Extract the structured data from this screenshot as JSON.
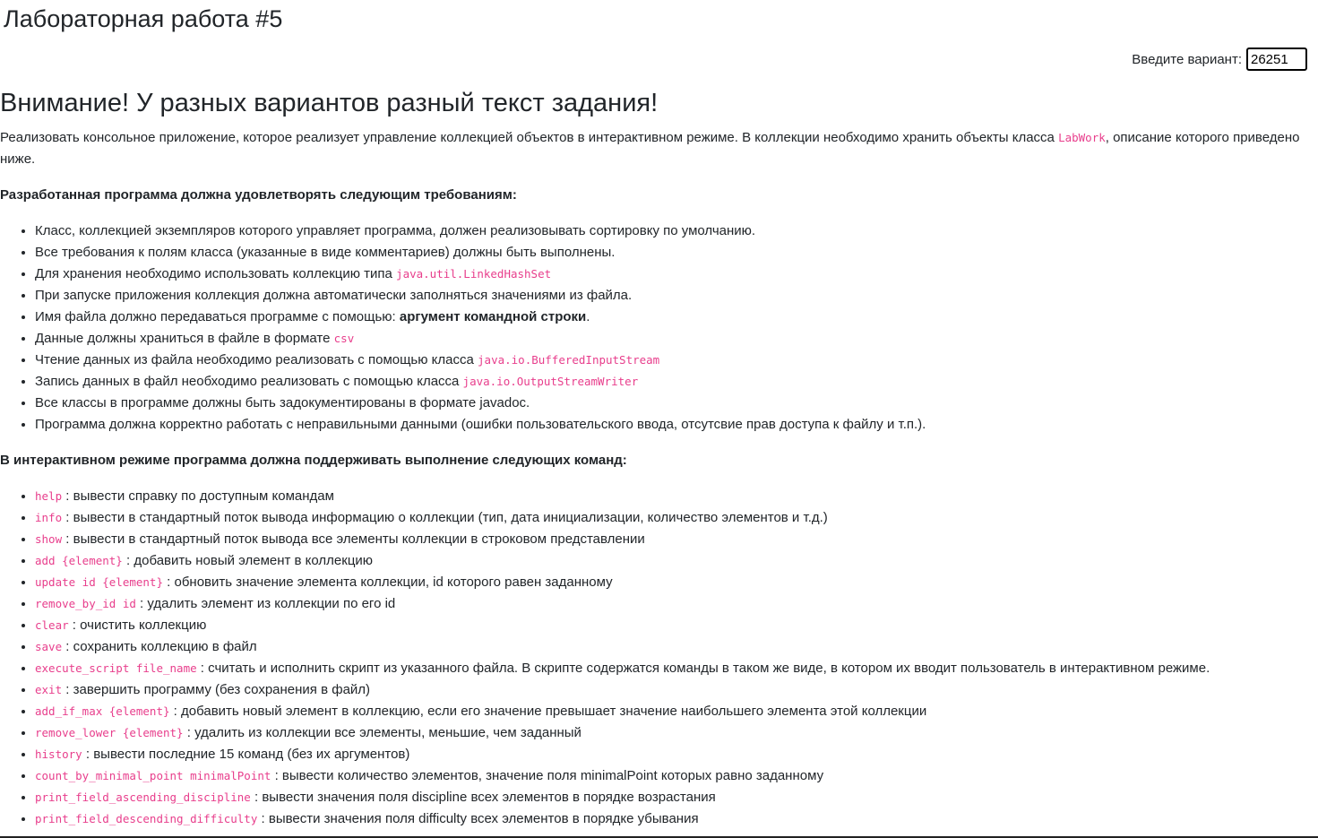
{
  "page": {
    "title": "Лабораторная работа #5"
  },
  "variant": {
    "label": "Введите вариант:",
    "value": "26251"
  },
  "warning": "Внимание! У разных вариантов разный текст задания!",
  "intro": {
    "before": "Реализовать консольное приложение, которое реализует управление коллекцией объектов в интерактивном режиме. В коллекции необходимо хранить объекты класса ",
    "code": "LabWork",
    "after": ", описание которого приведено ниже."
  },
  "requirements": {
    "heading": "Разработанная программа должна удовлетворять следующим требованиям:",
    "items": [
      {
        "text": "Класс, коллекцией экземпляров которого управляет программа, должен реализовывать сортировку по умолчанию."
      },
      {
        "text": "Все требования к полям класса (указанные в виде комментариев) должны быть выполнены."
      },
      {
        "text": "Для хранения необходимо использовать коллекцию типа ",
        "code": "java.util.LinkedHashSet"
      },
      {
        "text": "При запуске приложения коллекция должна автоматически заполняться значениями из файла."
      },
      {
        "text": "Имя файла должно передаваться программе с помощью: ",
        "bold": "аргумент командной строки",
        "after": "."
      },
      {
        "text": "Данные должны храниться в файле в формате ",
        "code": "csv"
      },
      {
        "text": "Чтение данных из файла необходимо реализовать с помощью класса ",
        "code": "java.io.BufferedInputStream"
      },
      {
        "text": "Запись данных в файл необходимо реализовать с помощью класса ",
        "code": "java.io.OutputStreamWriter"
      },
      {
        "text": "Все классы в программе должны быть задокументированы в формате javadoc."
      },
      {
        "text": "Программа должна корректно работать с неправильными данными (ошибки пользовательского ввода, отсутсвие прав доступа к файлу и т.п.)."
      }
    ]
  },
  "commands": {
    "heading": "В интерактивном режиме программа должна поддерживать выполнение следующих команд:",
    "items": [
      {
        "code": "help",
        "desc": " : вывести справку по доступным командам"
      },
      {
        "code": "info",
        "desc": " : вывести в стандартный поток вывода информацию о коллекции (тип, дата инициализации, количество элементов и т.д.)"
      },
      {
        "code": "show",
        "desc": " : вывести в стандартный поток вывода все элементы коллекции в строковом представлении"
      },
      {
        "code": "add {element}",
        "desc": " : добавить новый элемент в коллекцию"
      },
      {
        "code": "update id {element}",
        "desc": " : обновить значение элемента коллекции, id которого равен заданному"
      },
      {
        "code": "remove_by_id id",
        "desc": " : удалить элемент из коллекции по его id"
      },
      {
        "code": "clear",
        "desc": " : очистить коллекцию"
      },
      {
        "code": "save",
        "desc": " : сохранить коллекцию в файл"
      },
      {
        "code": "execute_script file_name",
        "desc": " : считать и исполнить скрипт из указанного файла. В скрипте содержатся команды в таком же виде, в котором их вводит пользователь в интерактивном режиме."
      },
      {
        "code": "exit",
        "desc": " : завершить программу (без сохранения в файл)"
      },
      {
        "code": "add_if_max {element}",
        "desc": " : добавить новый элемент в коллекцию, если его значение превышает значение наибольшего элемента этой коллекции"
      },
      {
        "code": "remove_lower {element}",
        "desc": " : удалить из коллекции все элементы, меньшие, чем заданный"
      },
      {
        "code": "history",
        "desc": " : вывести последние 15 команд (без их аргументов)"
      },
      {
        "code": "count_by_minimal_point minimalPoint",
        "desc": " : вывести количество элементов, значение поля minimalPoint которых равно заданному"
      },
      {
        "code": "print_field_ascending_discipline",
        "desc": " : вывести значения поля discipline всех элементов в порядке возрастания"
      },
      {
        "code": "print_field_descending_difficulty",
        "desc": " : вывести значения поля difficulty всех элементов в порядке убывания"
      }
    ]
  }
}
